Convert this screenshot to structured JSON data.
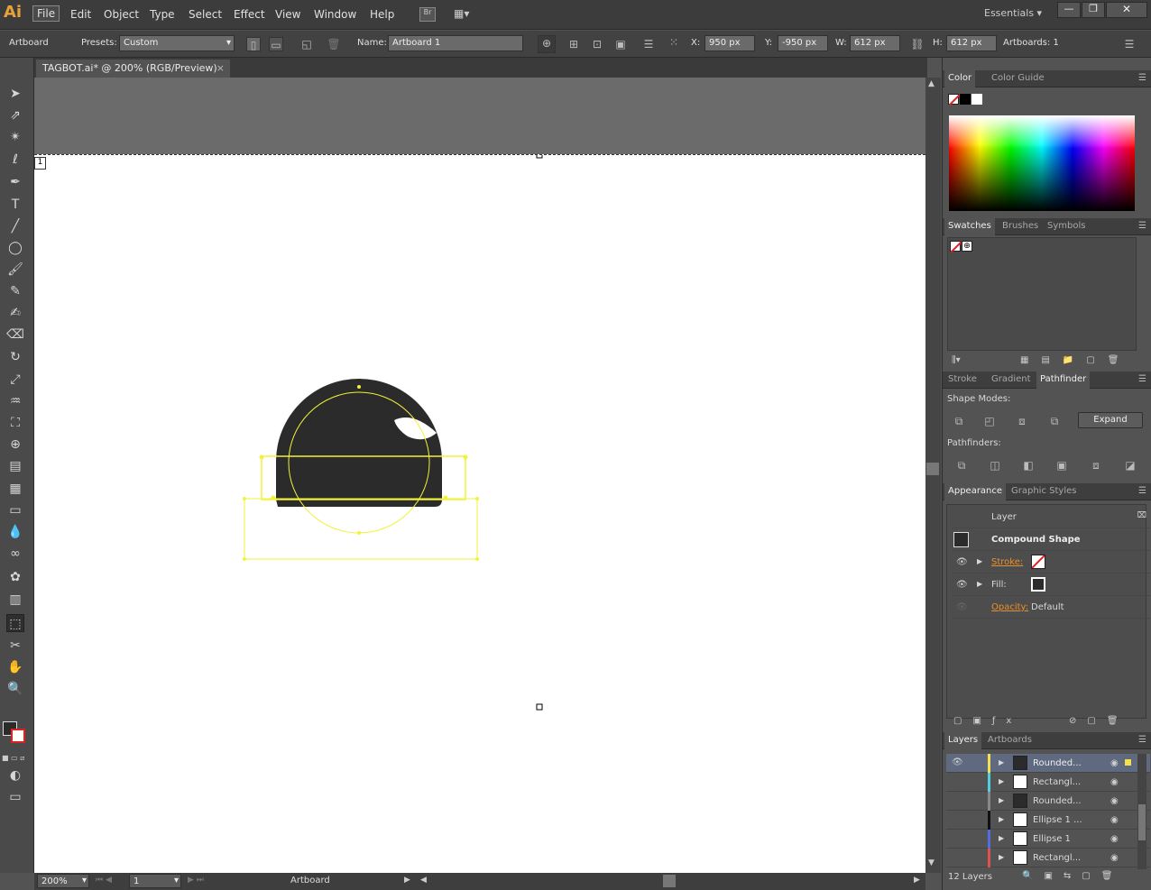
{
  "app": {
    "logo": "Ai"
  },
  "menu": [
    "File",
    "Edit",
    "Object",
    "Type",
    "Select",
    "Effect",
    "View",
    "Window",
    "Help"
  ],
  "workspace": {
    "name": "Essentials"
  },
  "control_bar": {
    "mode_label": "Artboard",
    "presets_label": "Presets:",
    "preset_value": "Custom",
    "name_label": "Name:",
    "name_value": "Artboard 1",
    "x_label": "X:",
    "x_value": "950 px",
    "y_label": "Y:",
    "y_value": "-950 px",
    "w_label": "W:",
    "w_value": "612 px",
    "h_label": "H:",
    "h_value": "612 px",
    "artboards_label": "Artboards:",
    "artboards_value": "1"
  },
  "document": {
    "tab_title": "TAGBOT.ai* @ 200% (RGB/Preview)",
    "artboard_number": "1"
  },
  "status": {
    "zoom": "200%",
    "page": "1",
    "tool": "Artboard"
  },
  "colors": {
    "accent_selection": "#f2f23a",
    "shape_fill": "#2b2b2b",
    "orange_link": "#e8902c"
  },
  "panels": {
    "color_tabs": [
      "Color",
      "Color Guide"
    ],
    "swatch_tabs": [
      "Swatches",
      "Brushes",
      "Symbols"
    ],
    "pathfinder_tabs": [
      "Stroke",
      "Gradient",
      "Pathfinder"
    ],
    "shape_modes_label": "Shape Modes:",
    "expand_label": "Expand",
    "pathfinders_label": "Pathfinders:",
    "appearance_tabs": [
      "Appearance",
      "Graphic Styles"
    ],
    "appearance": {
      "layer": "Layer",
      "object": "Compound Shape",
      "stroke_label": "Stroke:",
      "fill_label": "Fill:",
      "opacity_label": "Opacity:",
      "opacity_value": "Default"
    },
    "layers_tabs": [
      "Layers",
      "Artboards"
    ],
    "layers": [
      {
        "name": "Rounded...",
        "color": "#f4e04a"
      },
      {
        "name": "Rectangl...",
        "color": "#4fd0e0"
      },
      {
        "name": "Rounded...",
        "color": "#888888"
      },
      {
        "name": "Ellipse 1 ...",
        "color": "#111111"
      },
      {
        "name": "Ellipse 1",
        "color": "#4f6ee0"
      },
      {
        "name": "Rectangl...",
        "color": "#e05050"
      }
    ],
    "layers_count": "12 Layers"
  }
}
